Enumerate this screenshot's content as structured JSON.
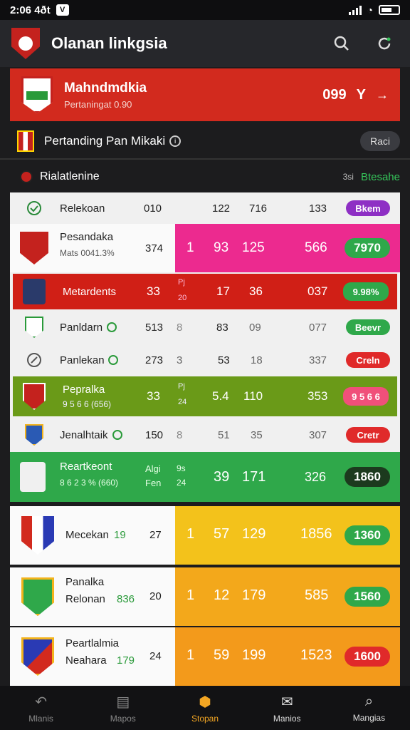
{
  "status": {
    "time": "2:06 4ðt",
    "badge": "V"
  },
  "header": {
    "title": "Olanan linkgsia",
    "search_icon": "search-icon",
    "refresh_icon": "refresh-icon"
  },
  "hero": {
    "title": "Mahndmdkia",
    "subtitle": "Pertaningat 0.90",
    "score": "099",
    "suffix": "Y",
    "arrow": "→"
  },
  "section1": {
    "label": "Pertanding Pan Mikaki",
    "info": "i",
    "pill": "Raci"
  },
  "section2": {
    "label": "Rialatlenine",
    "small": "3si",
    "green": "Btesahe"
  },
  "table": {
    "header": {
      "label": "Relekoan",
      "c1": "010",
      "c2": "122",
      "c3": "716",
      "c4": "133",
      "pill": "Bkem"
    },
    "rows": [
      {
        "name": "Pesandaka",
        "sub": "Mats 0041.3%",
        "c1": "374",
        "c2": "1",
        "c3": "93",
        "c4": "125",
        "c5": "566",
        "pill": "7970"
      },
      {
        "name": "Metardents",
        "c1": "33",
        "c2a": "Pj",
        "c2b": "20",
        "c3": "17",
        "c4": "36",
        "c5": "037",
        "pill": "9.98%"
      },
      {
        "name": "Panldarn",
        "c1": "513",
        "c2": "8",
        "c3": "83",
        "c4": "09",
        "c5": "077",
        "pill": "Beevr"
      },
      {
        "name": "Panlekan",
        "c1": "273",
        "c2": "3",
        "c3": "53",
        "c4": "18",
        "c5": "337",
        "pill": "Creln"
      },
      {
        "name": "Pepralka",
        "sub": "9 5 6 6 (656)",
        "c1": "33",
        "c2a": "Pj",
        "c2b": "24",
        "c3": "5.4",
        "c4": "110",
        "c5": "353",
        "pill": "9 5 6 6"
      },
      {
        "name": "Jenalhtaik",
        "c1": "150",
        "c2": "8",
        "c3": "51",
        "c4": "35",
        "c5": "307",
        "pill": "Cretr"
      },
      {
        "name": "Reartkeont",
        "sub": "8 6 2 3 % (660)",
        "c1a": "Algi",
        "c1b": "Fen",
        "c2a": "9s",
        "c2b": "24",
        "c3": "39",
        "c4": "171",
        "c5": "326",
        "pill": "1860"
      }
    ]
  },
  "cards": [
    {
      "name": "Mecekan",
      "num": "19",
      "c1": "27",
      "c2": "1",
      "c3": "57",
      "c4": "129",
      "c5": "1856",
      "pill": "1360"
    },
    {
      "name": "Panalka",
      "sub": "Relonan",
      "num": "836",
      "c1": "20",
      "c2": "1",
      "c3": "12",
      "c4": "179",
      "c5": "585",
      "pill": "1560"
    },
    {
      "name": "Peartlalmia",
      "sub": "Neahara",
      "num": "179",
      "c1": "24",
      "c2": "1",
      "c3": "59",
      "c4": "199",
      "c5": "1523",
      "pill": "1600"
    }
  ],
  "tabs": [
    {
      "label": "Mlanis",
      "icon": "back-icon"
    },
    {
      "label": "Mapos",
      "icon": "list-icon"
    },
    {
      "label": "Stopan",
      "icon": "hexagon-icon"
    },
    {
      "label": "Manios",
      "icon": "mail-icon"
    },
    {
      "label": "Mangias",
      "icon": "search-icon"
    }
  ],
  "colors": {
    "red": "#d22a1e",
    "magenta": "#ec2a8f",
    "olive": "#6a9a18",
    "green": "#2fa84a",
    "amber": "#f3b31b",
    "orange": "#f39a1b"
  }
}
